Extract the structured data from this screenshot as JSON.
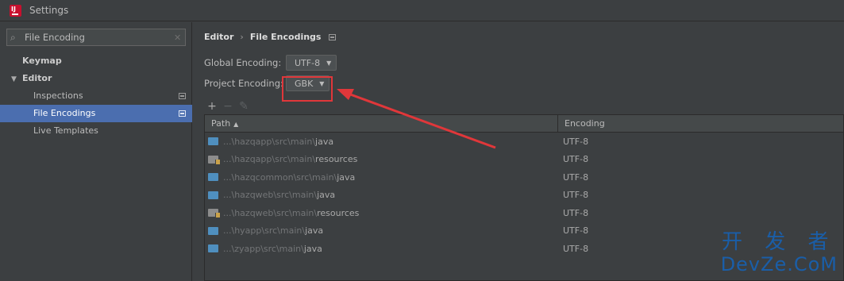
{
  "window": {
    "title": "Settings"
  },
  "search": {
    "value": "File Encoding"
  },
  "sidebar": {
    "items": [
      {
        "label": "Keymap"
      },
      {
        "label": "Editor"
      },
      {
        "label": "Inspections"
      },
      {
        "label": "File Encodings"
      },
      {
        "label": "Live Templates"
      }
    ]
  },
  "breadcrumb": {
    "parent": "Editor",
    "separator": "›",
    "current": "File Encodings"
  },
  "global_encoding": {
    "label": "Global Encoding:",
    "value": "UTF-8"
  },
  "project_encoding": {
    "label": "Project Encoding:",
    "value": "GBK"
  },
  "toolbar": {
    "add": "+",
    "remove": "−",
    "edit": "✎"
  },
  "table": {
    "headers": {
      "path": "Path",
      "encoding": "Encoding"
    },
    "rows": [
      {
        "prefix": "...\\",
        "module": "hazqapp\\src\\main\\",
        "leaf": "java",
        "encoding": "UTF-8",
        "icon": "source-folder"
      },
      {
        "prefix": "...\\",
        "module": "hazqapp\\src\\main\\",
        "leaf": "resources",
        "encoding": "UTF-8",
        "icon": "resources-folder"
      },
      {
        "prefix": "...\\",
        "module": "hazqcommon\\src\\main\\",
        "leaf": "java",
        "encoding": "UTF-8",
        "icon": "source-folder"
      },
      {
        "prefix": "...\\",
        "module": "hazqweb\\src\\main\\",
        "leaf": "java",
        "encoding": "UTF-8",
        "icon": "source-folder"
      },
      {
        "prefix": "...\\",
        "module": "hazqweb\\src\\main\\",
        "leaf": "resources",
        "encoding": "UTF-8",
        "icon": "resources-folder"
      },
      {
        "prefix": "...\\",
        "module": "hyapp\\src\\main\\",
        "leaf": "java",
        "encoding": "UTF-8",
        "icon": "source-folder"
      },
      {
        "prefix": "...\\",
        "module": "zyapp\\src\\main\\",
        "leaf": "java",
        "encoding": "UTF-8",
        "icon": "source-folder"
      }
    ]
  },
  "watermark": {
    "line1": "开 发 者",
    "line2": "DevZe.CoM"
  },
  "colors": {
    "selection": "#4b6eaf",
    "annotation": "#e0373a",
    "background": "#3c3f41"
  }
}
